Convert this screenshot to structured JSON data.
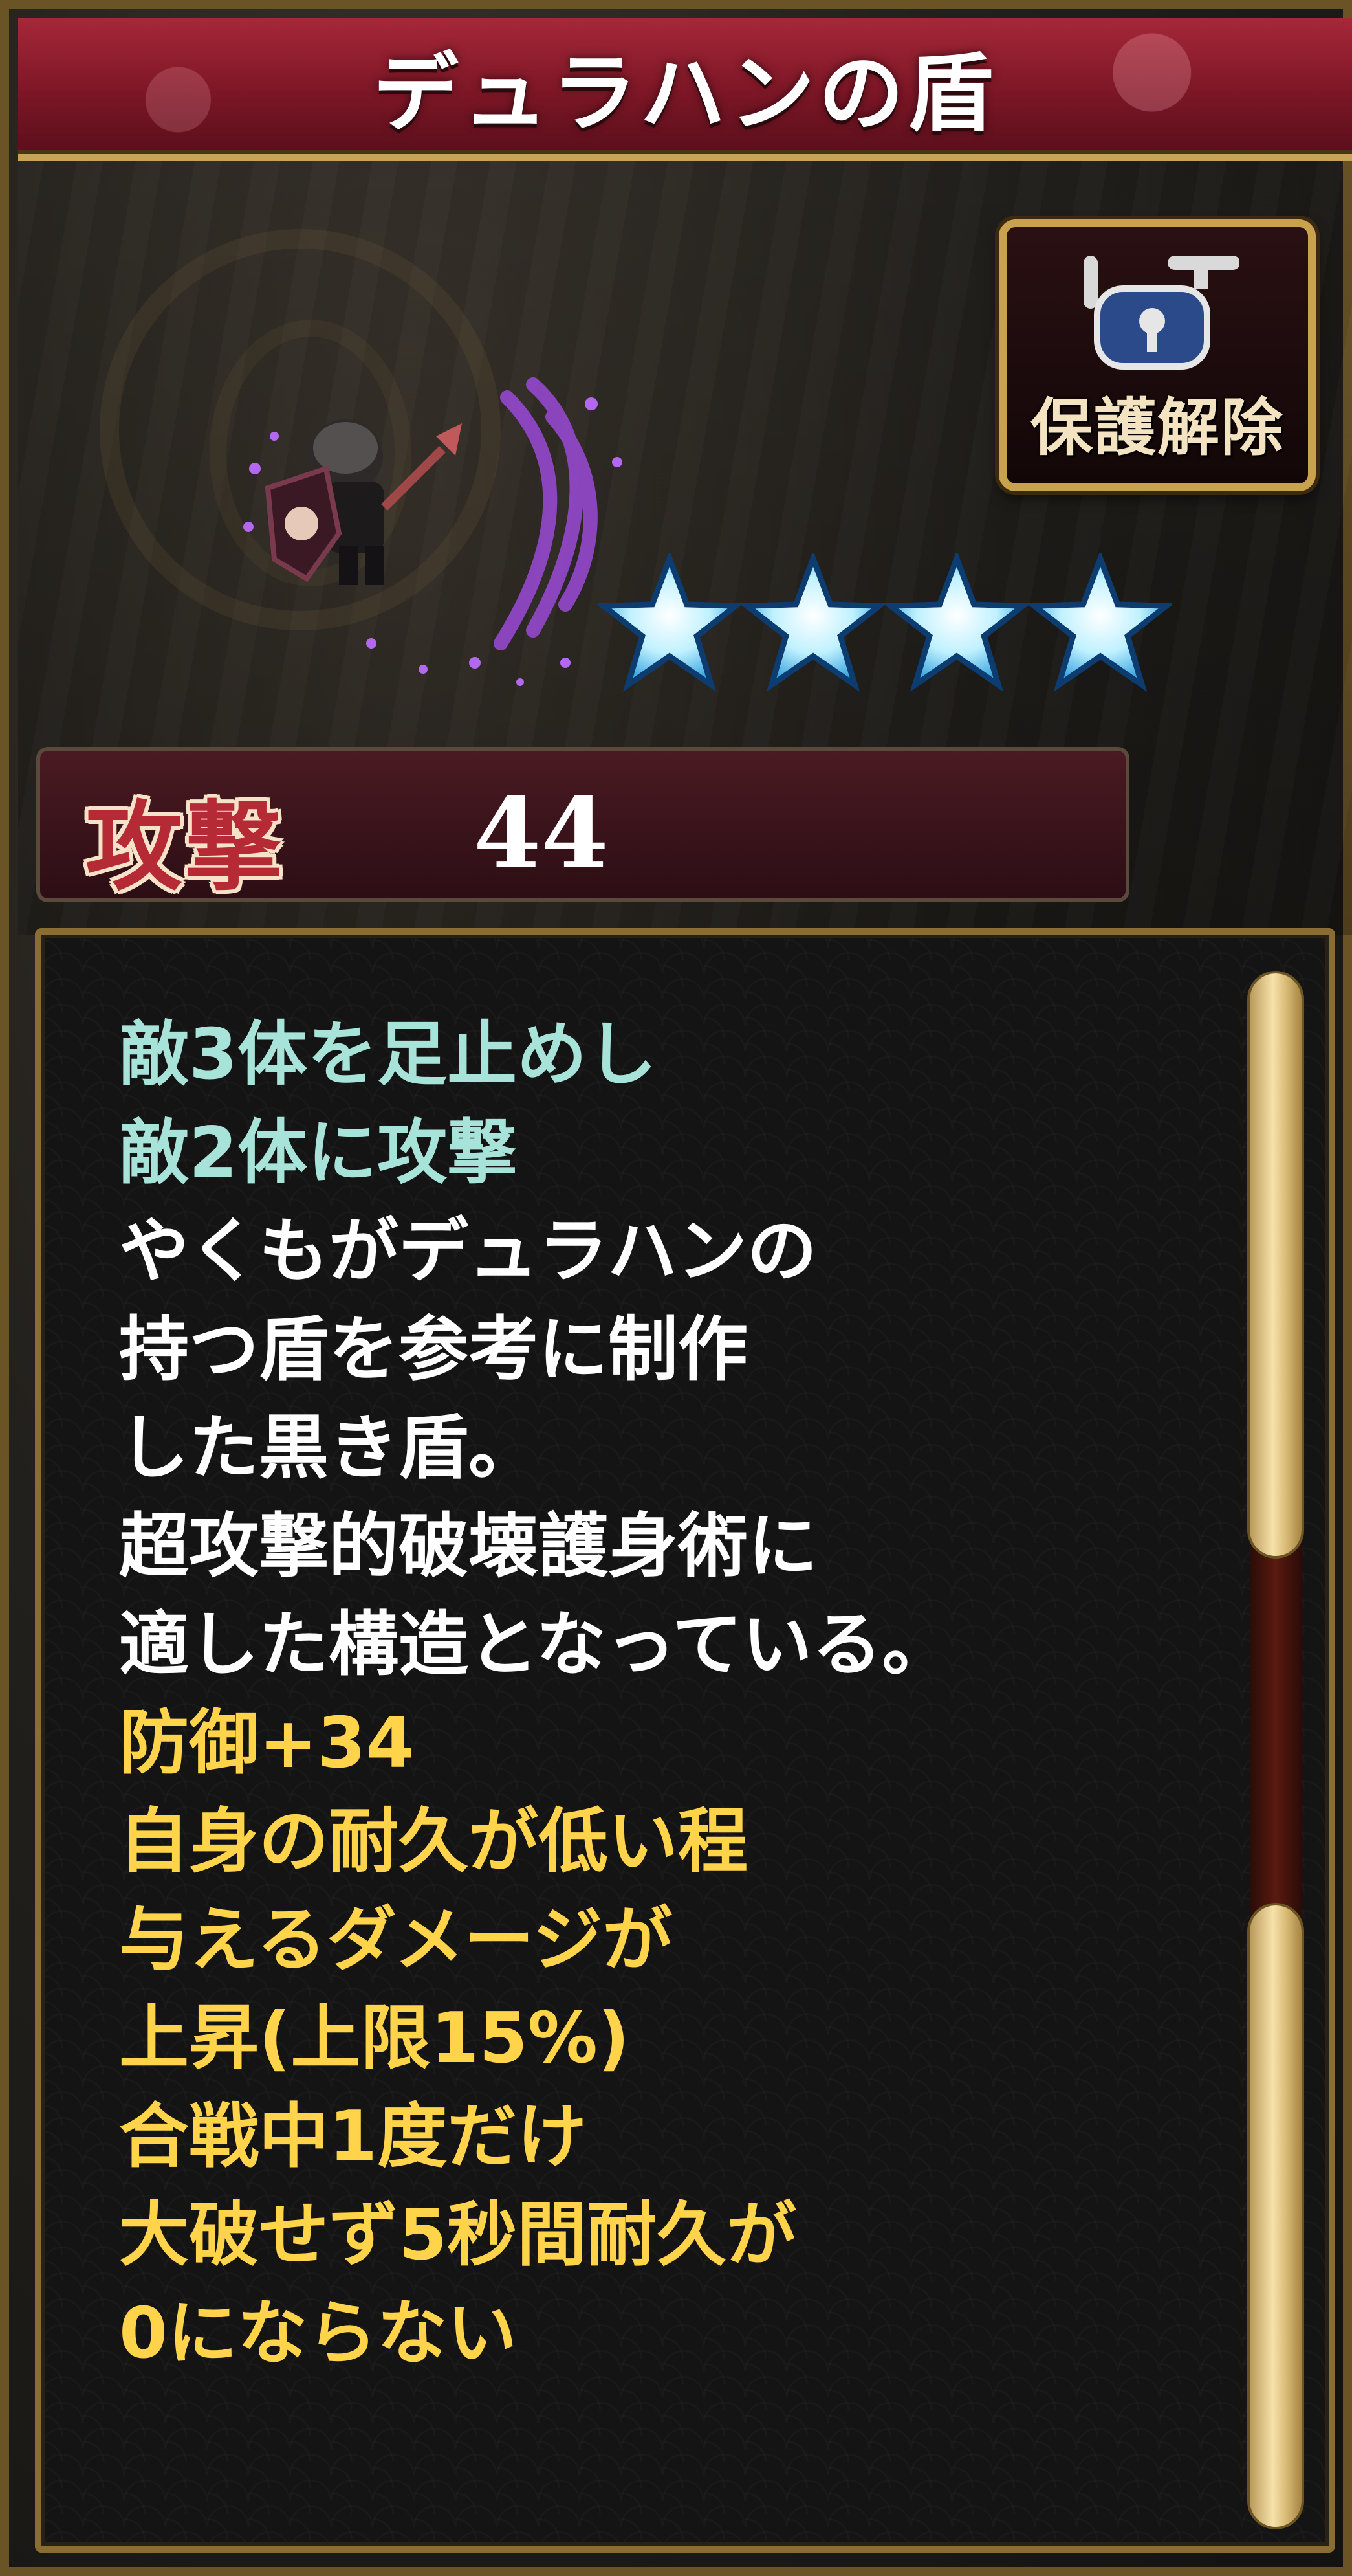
{
  "title": "デュラハンの盾",
  "unprotect_button": {
    "label": "保護解除",
    "icon": "lock-open-icon"
  },
  "rarity": {
    "stars": 4
  },
  "stat": {
    "label": "攻撃",
    "value": "44"
  },
  "description": {
    "lines": [
      {
        "text": "敵3体を足止めし",
        "color": "cyan"
      },
      {
        "text": "敵2体に攻撃",
        "color": "cyan"
      },
      {
        "text": "やくもがデュラハンの",
        "color": "white"
      },
      {
        "text": "持つ盾を参考に制作",
        "color": "white"
      },
      {
        "text": "した黒き盾。",
        "color": "white"
      },
      {
        "text": "超攻撃的破壊護身術に",
        "color": "white"
      },
      {
        "text": "適した構造となっている。",
        "color": "white"
      },
      {
        "text": "防御+34",
        "color": "yellow"
      },
      {
        "text": "自身の耐久が低い程",
        "color": "yellow"
      },
      {
        "text": "与えるダメージが",
        "color": "yellow"
      },
      {
        "text": "上昇(上限15%)",
        "color": "yellow"
      },
      {
        "text": "合戦中1度だけ",
        "color": "yellow"
      },
      {
        "text": "大破せず5秒間耐久が",
        "color": "yellow"
      },
      {
        "text": "0にならない",
        "color": "yellow"
      }
    ]
  },
  "colors": {
    "cyan": "#a7e3d8",
    "white": "#ffffff",
    "yellow": "#ffd34a",
    "title_banner": "#8a1c2c",
    "frame_gold": "#c9a24e"
  }
}
